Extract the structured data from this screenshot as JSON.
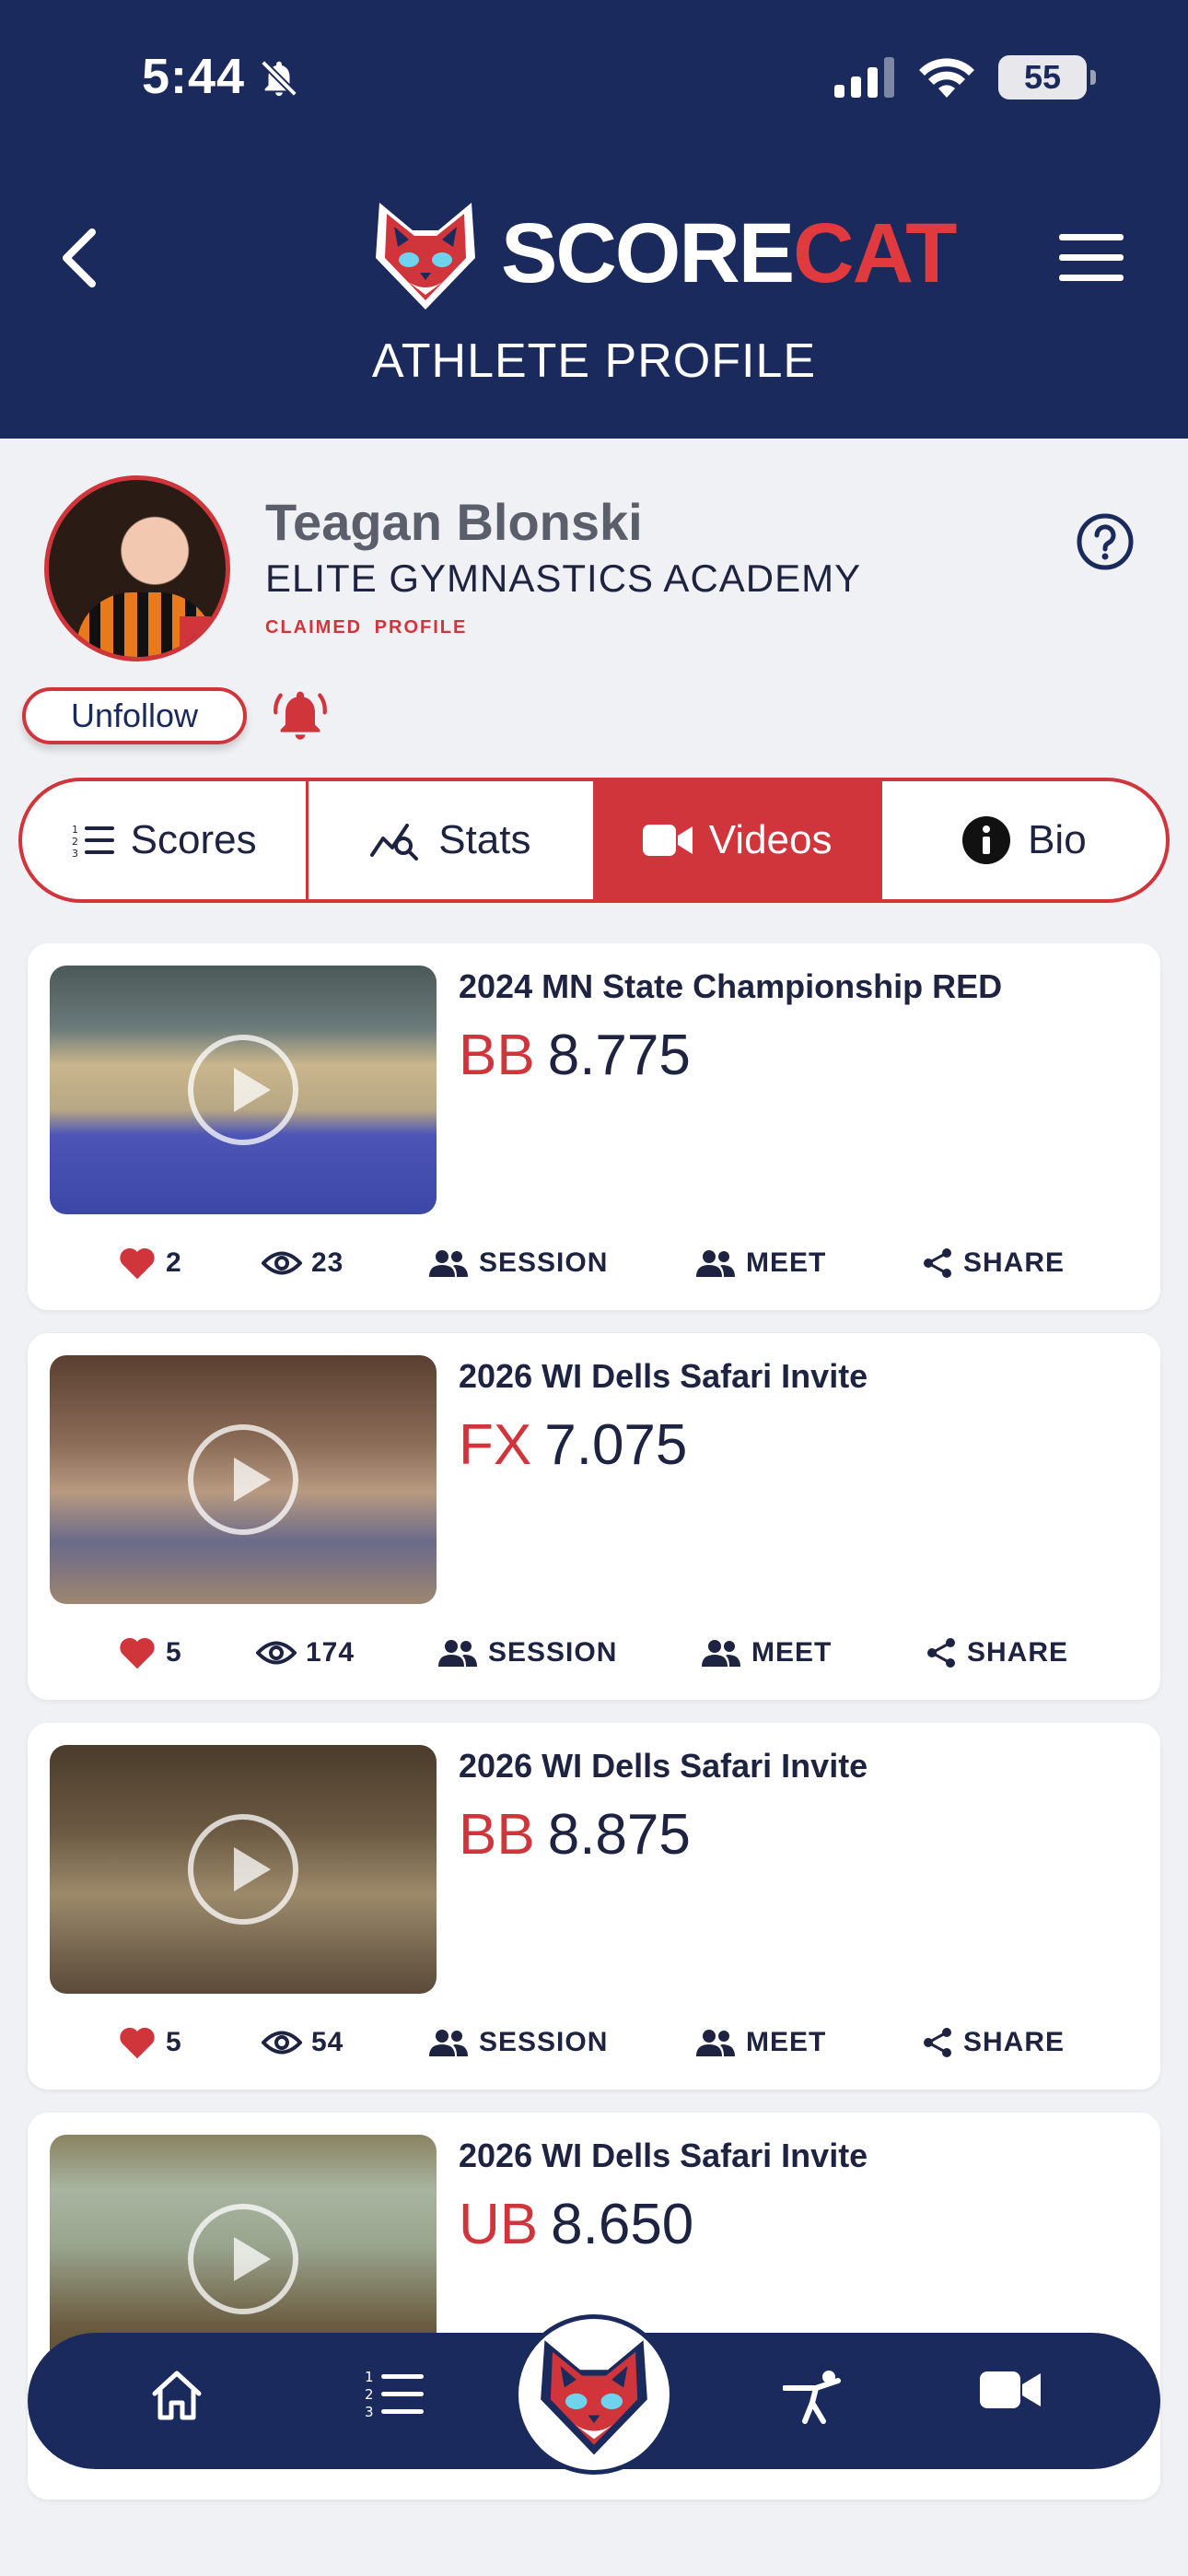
{
  "status_bar": {
    "time": "5:44",
    "battery": "55"
  },
  "header": {
    "brand_score": "SCORE",
    "brand_cat": "CAT",
    "title": "ATHLETE PROFILE"
  },
  "profile": {
    "name": "Teagan Blonski",
    "academy": "ELITE GYMNASTICS ACADEMY",
    "claimed_label": "CLAIMED PROFILE",
    "unfollow_label": "Unfollow"
  },
  "tabs": [
    {
      "label": "Scores",
      "icon": "numbered-list-icon",
      "active": false
    },
    {
      "label": "Stats",
      "icon": "chart-search-icon",
      "active": false
    },
    {
      "label": "Videos",
      "icon": "video-camera-icon",
      "active": true
    },
    {
      "label": "Bio",
      "icon": "info-icon",
      "active": false
    }
  ],
  "action_labels": {
    "session": "SESSION",
    "meet": "MEET",
    "share": "SHARE"
  },
  "videos": [
    {
      "title": "2024 MN State Championship RED",
      "event": "BB",
      "score": "8.775",
      "likes": "2",
      "views": "23"
    },
    {
      "title": "2026 WI Dells Safari Invite",
      "event": "FX",
      "score": "7.075",
      "likes": "5",
      "views": "174"
    },
    {
      "title": "2026 WI Dells Safari Invite",
      "event": "BB",
      "score": "8.875",
      "likes": "5",
      "views": "54"
    },
    {
      "title": "2026 WI Dells Safari Invite",
      "event": "UB",
      "score": "8.650",
      "likes": "",
      "views": ""
    }
  ],
  "colors": {
    "navy": "#1b2a5c",
    "red": "#d0353b",
    "background": "#f0f1f5"
  },
  "bottom_nav": [
    "home-icon",
    "numbered-list-icon",
    "scorecat-logo",
    "gymnast-icon",
    "video-camera-icon"
  ]
}
